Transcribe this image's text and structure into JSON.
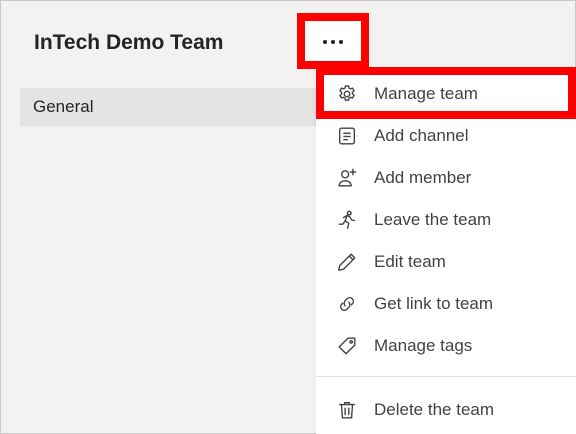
{
  "team": {
    "name": "InTech Demo Team"
  },
  "channels": [
    {
      "label": "General"
    }
  ],
  "menu": {
    "items": [
      {
        "label": "Manage team",
        "icon": "gear-icon"
      },
      {
        "label": "Add channel",
        "icon": "channel-list-icon"
      },
      {
        "label": "Add member",
        "icon": "add-person-icon"
      },
      {
        "label": "Leave the team",
        "icon": "running-person-icon"
      },
      {
        "label": "Edit team",
        "icon": "pencil-icon"
      },
      {
        "label": "Get link to team",
        "icon": "link-icon"
      },
      {
        "label": "Manage tags",
        "icon": "tag-icon"
      },
      {
        "label": "Delete the team",
        "icon": "trash-icon"
      }
    ]
  },
  "colors": {
    "highlight": "#ff0000",
    "sidebar": "#f3f2f1",
    "text": "#424242"
  }
}
